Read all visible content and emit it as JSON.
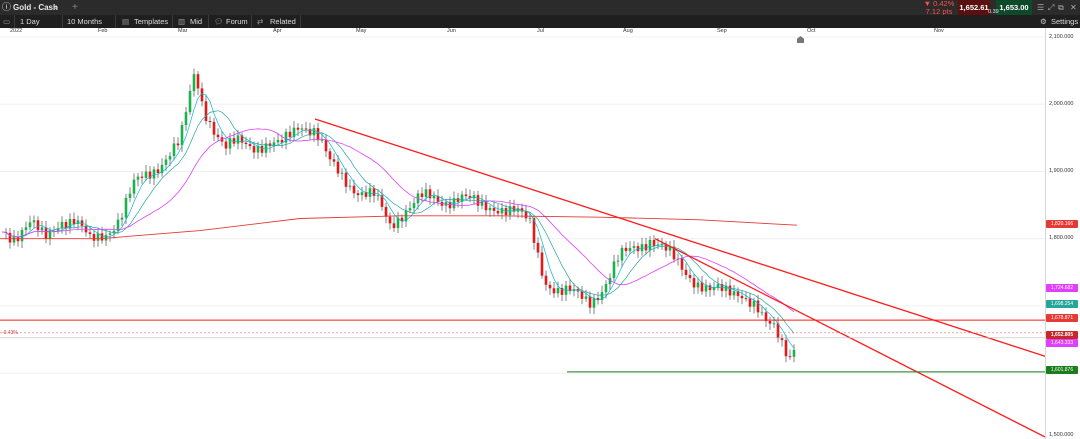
{
  "instrument": {
    "title": "Gold - Cash",
    "add_label": "+",
    "change_pct": "▼ 0.42%",
    "change_pts": "7.12 pts",
    "bid": "1,652.61",
    "ask": "1,653.00",
    "spread": "0.39"
  },
  "toolbar": {
    "interval": "1 Day",
    "range": "10 Months",
    "templates": "Templates",
    "price_type": "Mid",
    "forum": "Forum",
    "related": "Related",
    "settings": "Settings"
  },
  "time_axis": {
    "labels": [
      "2022",
      "Feb",
      "Mar",
      "Apr",
      "May",
      "Jun",
      "Jul",
      "Aug",
      "Sep",
      "Oct",
      "Nov"
    ]
  },
  "price_axis": {
    "labels": [
      "2,100.000",
      "2,000.000",
      "1,900.000",
      "1,800.000",
      "1,500.000"
    ]
  },
  "tags": {
    "ma200": "1,820.166",
    "ma_magenta": "1,724.682",
    "ma_teal": "1,698.254",
    "resistance": "1,678.871",
    "current": "1,652.805",
    "ma_pink": "1,643.333",
    "support": "1,601.876"
  },
  "left_label": "-0.43%",
  "colors": {
    "up": "#1bb24c",
    "down": "#e41a1a",
    "ma_fast": "#00bcd4",
    "ma_mid": "#26a69a",
    "ma_magenta": "#e040fb",
    "ma_200": "#e53935",
    "trendline": "#ff1a1a",
    "support": "#1b7d1b"
  },
  "chart_data": {
    "type": "candlestick",
    "ylim": [
      1500,
      2100
    ],
    "x": [
      "2022-01",
      "2022-02",
      "2022-03",
      "2022-04",
      "2022-05",
      "2022-06",
      "2022-07",
      "2022-08",
      "2022-09",
      "2022-10",
      "2022-11"
    ],
    "close": [
      1820,
      1800,
      1910,
      1970,
      1930,
      1840,
      1850,
      1770,
      1780,
      1800,
      1710,
      1680,
      1652.8
    ],
    "ma200_last": 1820.166,
    "support": 1601.876,
    "resistance": 1678.871
  }
}
